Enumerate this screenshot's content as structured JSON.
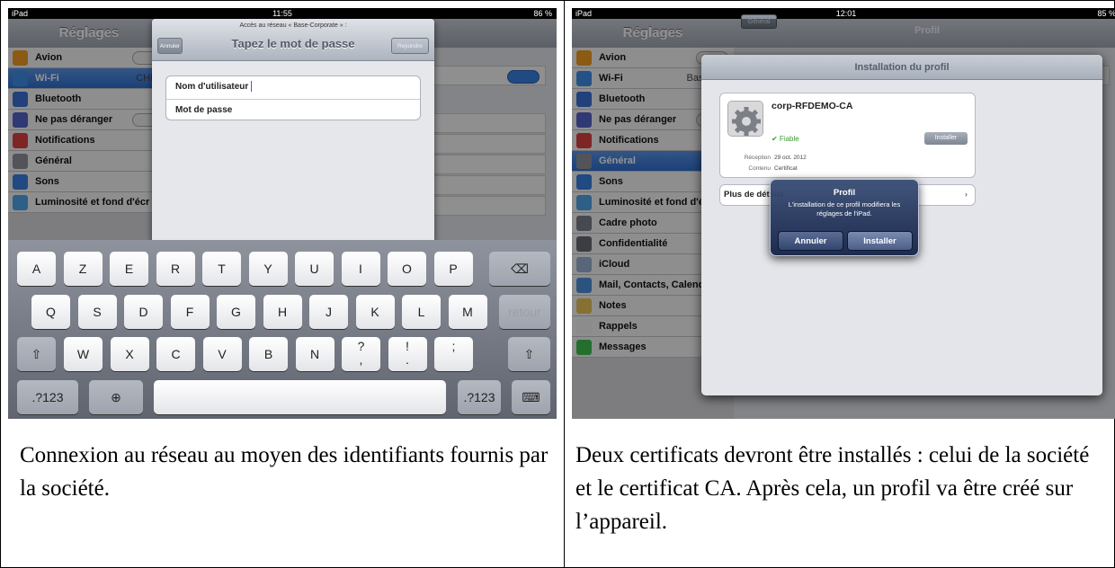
{
  "left_shot": {
    "status": {
      "device": "iPad",
      "time": "11:55",
      "battery": "86 %"
    },
    "sidebar_title": "Réglages",
    "sidebar_items": [
      {
        "label": "Avion",
        "value": ""
      },
      {
        "label": "Wi-Fi",
        "value": "CHRC"
      },
      {
        "label": "Bluetooth",
        "value": ""
      },
      {
        "label": "Ne pas déranger",
        "value": ""
      },
      {
        "label": "Notifications",
        "value": ""
      },
      {
        "label": "Général",
        "value": ""
      },
      {
        "label": "Sons",
        "value": ""
      },
      {
        "label": "Luminosité et fond d'écr",
        "value": ""
      }
    ],
    "dialog": {
      "subtitle": "Accès au réseau « Base-Corporate » :",
      "title": "Tapez le mot de passe",
      "cancel_label": "Annuler",
      "join_label": "Rejoindre",
      "username_label": "Nom d'utilisateur",
      "password_label": "Mot de passe"
    },
    "keyboard": {
      "row1": [
        "A",
        "Z",
        "E",
        "R",
        "T",
        "Y",
        "U",
        "I",
        "O",
        "P"
      ],
      "row2": [
        "Q",
        "S",
        "D",
        "F",
        "G",
        "H",
        "J",
        "K",
        "L",
        "M"
      ],
      "row3": [
        "W",
        "X",
        "C",
        "V",
        "B",
        "N"
      ],
      "row3_punct": [
        "?\n,",
        "!\n.",
        ";"
      ],
      "return_label": "retour",
      "numbers_label": ".?123",
      "backspace": "⌫",
      "shift": "⇧",
      "globe": "⊕",
      "hide_kb": "⌨"
    }
  },
  "right_shot": {
    "status": {
      "device": "iPad",
      "time": "12:01",
      "battery": "85 %"
    },
    "sidebar_title": "Réglages",
    "back_label": "Général",
    "main_title": "Profil",
    "sidebar_items": [
      {
        "label": "Avion",
        "value": ""
      },
      {
        "label": "Wi-Fi",
        "value": "Base-Cor"
      },
      {
        "label": "Bluetooth",
        "value": ""
      },
      {
        "label": "Ne pas déranger",
        "value": ""
      },
      {
        "label": "Notifications",
        "value": ""
      },
      {
        "label": "Général",
        "value": ""
      },
      {
        "label": "Sons",
        "value": ""
      },
      {
        "label": "Luminosité et fond d'écr",
        "value": ""
      },
      {
        "label": "Cadre photo",
        "value": ""
      },
      {
        "label": "Confidentialité",
        "value": ""
      },
      {
        "label": "iCloud",
        "value": ""
      },
      {
        "label": "Mail, Contacts, Calendri",
        "value": ""
      },
      {
        "label": "Notes",
        "value": ""
      },
      {
        "label": "Rappels",
        "value": ""
      },
      {
        "label": "Messages",
        "value": ""
      }
    ],
    "profile_dialog": {
      "title": "Installation du profil",
      "profile_name": "corp-RFDEMO-CA",
      "trust": "✔ Fiable",
      "install_label": "Installer",
      "received_label": "Réception",
      "received_value": "29 oct. 2012",
      "content_label": "Contenu",
      "content_value": "Certificat",
      "more_details": "Plus de détails"
    },
    "alert": {
      "title": "Profil",
      "message": "L'installation de ce profil modifiera les réglages de l'iPad.",
      "cancel_label": "Annuler",
      "install_label": "Installer"
    }
  },
  "captions": {
    "left": "Connexion au réseau au moyen des identifiants fournis par la société.",
    "right": "Deux certificats devront être installés : celui de la société et le certificat CA. Après cela, un profil va être créé sur l’appareil."
  },
  "colors": {
    "accent_blue": "#2f6fd0",
    "trusted_green": "#3d9a37",
    "alert_navy": "#1f3466"
  }
}
